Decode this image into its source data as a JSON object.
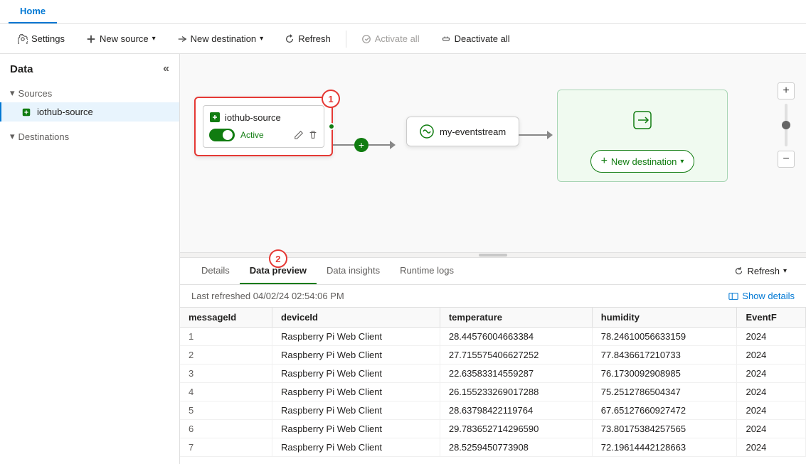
{
  "tab": {
    "label": "Home"
  },
  "toolbar": {
    "settings_label": "Settings",
    "new_source_label": "New source",
    "new_destination_label": "New destination",
    "refresh_label": "Refresh",
    "activate_all_label": "Activate all",
    "deactivate_all_label": "Deactivate all"
  },
  "sidebar": {
    "title": "Data",
    "sources_label": "Sources",
    "source_item": "iothub-source",
    "destinations_label": "Destinations"
  },
  "canvas": {
    "source_node": {
      "title": "iothub-source",
      "status": "Active"
    },
    "eventstream_node": {
      "title": "my-eventstream"
    },
    "destination_node": {
      "btn_label": "New destination"
    },
    "annotation1": "1",
    "annotation2": "2"
  },
  "bottom_panel": {
    "tabs": [
      {
        "label": "Details",
        "active": false
      },
      {
        "label": "Data preview",
        "active": true
      },
      {
        "label": "Data insights",
        "active": false
      },
      {
        "label": "Runtime logs",
        "active": false
      }
    ],
    "refresh_label": "Refresh",
    "show_details_label": "Show details",
    "last_refreshed_label": "Last refreshed",
    "last_refreshed_value": "04/02/24 02:54:06 PM"
  },
  "table": {
    "columns": [
      "messageId",
      "deviceId",
      "temperature",
      "humidity",
      "EventF"
    ],
    "rows": [
      {
        "num": "1",
        "messageId": "1",
        "deviceId": "Raspberry Pi Web Client",
        "temperature": "28.44576004663384",
        "humidity": "78.24610056633159",
        "eventF": "2024"
      },
      {
        "num": "2",
        "messageId": "2",
        "deviceId": "Raspberry Pi Web Client",
        "temperature": "27.715575406627252",
        "humidity": "77.8436617210733",
        "eventF": "2024"
      },
      {
        "num": "3",
        "messageId": "3",
        "deviceId": "Raspberry Pi Web Client",
        "temperature": "22.63583314559287",
        "humidity": "76.1730092908985",
        "eventF": "2024"
      },
      {
        "num": "4",
        "messageId": "4",
        "deviceId": "Raspberry Pi Web Client",
        "temperature": "26.155233269017288",
        "humidity": "75.2512786504347",
        "eventF": "2024"
      },
      {
        "num": "5",
        "messageId": "5",
        "deviceId": "Raspberry Pi Web Client",
        "temperature": "28.63798422119764",
        "humidity": "67.65127660927472",
        "eventF": "2024"
      },
      {
        "num": "6",
        "messageId": "6",
        "deviceId": "Raspberry Pi Web Client",
        "temperature": "29.783652714296590",
        "humidity": "73.80175384257565",
        "eventF": "2024"
      },
      {
        "num": "7",
        "messageId": "7",
        "deviceId": "Raspberry Pi Web Client",
        "temperature": "28.5259450773908",
        "humidity": "72.19614442128663",
        "eventF": "2024"
      }
    ]
  },
  "colors": {
    "active_green": "#107c10",
    "accent_blue": "#0078d4",
    "border_red": "#e53935"
  }
}
